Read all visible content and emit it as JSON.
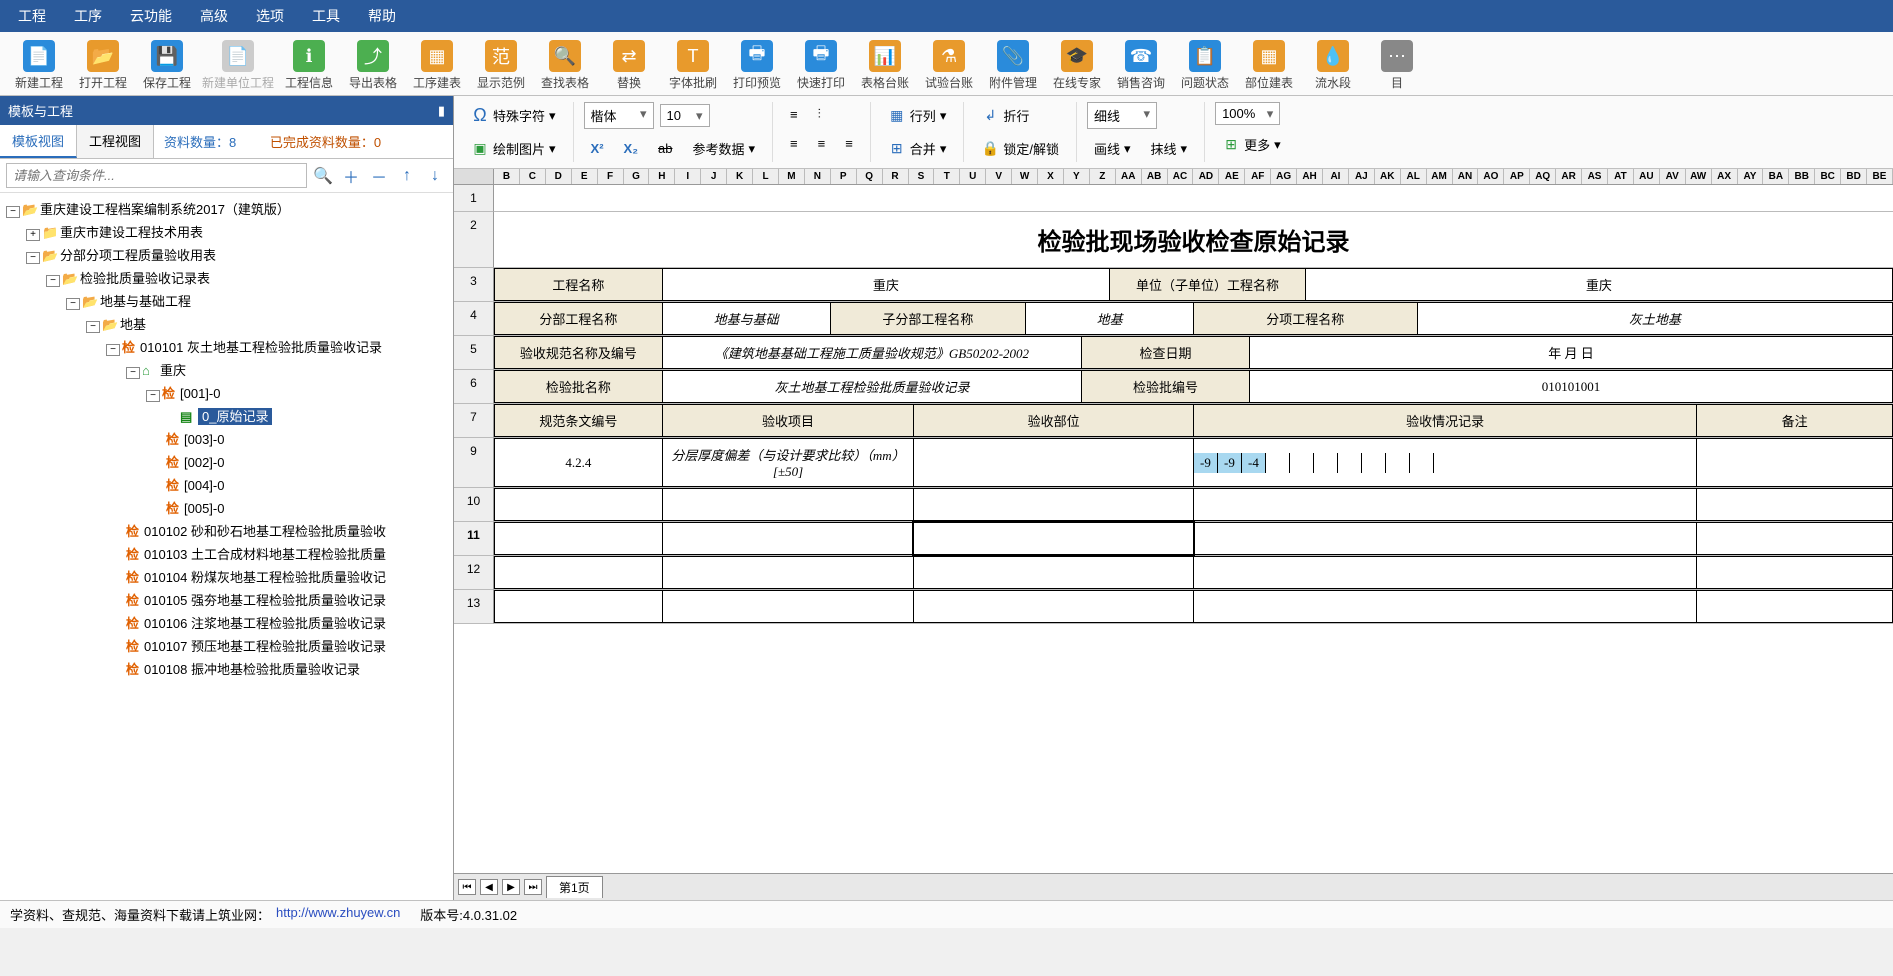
{
  "menu": [
    "工程",
    "工序",
    "云功能",
    "高级",
    "选项",
    "工具",
    "帮助"
  ],
  "toolbar": [
    {
      "label": "新建工程",
      "color": "#2a8bdb",
      "glyph": "📄"
    },
    {
      "label": "打开工程",
      "color": "#e89a2c",
      "glyph": "📂"
    },
    {
      "label": "保存工程",
      "color": "#2a8bdb",
      "glyph": "💾"
    },
    {
      "label": "新建单位工程",
      "color": "#cccccc",
      "glyph": "📄",
      "disabled": true
    },
    {
      "label": "工程信息",
      "color": "#4caf50",
      "glyph": "ℹ"
    },
    {
      "label": "导出表格",
      "color": "#4caf50",
      "glyph": "⤴"
    },
    {
      "label": "工序建表",
      "color": "#e89a2c",
      "glyph": "▦"
    },
    {
      "label": "显示范例",
      "color": "#e89a2c",
      "glyph": "范"
    },
    {
      "label": "查找表格",
      "color": "#e89a2c",
      "glyph": "🔍"
    },
    {
      "label": "替换",
      "color": "#e89a2c",
      "glyph": "⇄"
    },
    {
      "label": "字体批刷",
      "color": "#e89a2c",
      "glyph": "T"
    },
    {
      "label": "打印预览",
      "color": "#2a8bdb",
      "glyph": "🖶"
    },
    {
      "label": "快速打印",
      "color": "#2a8bdb",
      "glyph": "🖶"
    },
    {
      "label": "表格台账",
      "color": "#e89a2c",
      "glyph": "📊"
    },
    {
      "label": "试验台账",
      "color": "#e89a2c",
      "glyph": "⚗"
    },
    {
      "label": "附件管理",
      "color": "#2a8bdb",
      "glyph": "📎"
    },
    {
      "label": "在线专家",
      "color": "#e89a2c",
      "glyph": "🎓"
    },
    {
      "label": "销售咨询",
      "color": "#2a8bdb",
      "glyph": "☎"
    },
    {
      "label": "问题状态",
      "color": "#2a8bdb",
      "glyph": "📋"
    },
    {
      "label": "部位建表",
      "color": "#e89a2c",
      "glyph": "▦"
    },
    {
      "label": "流水段",
      "color": "#e89a2c",
      "glyph": "💧"
    },
    {
      "label": "目",
      "color": "#888",
      "glyph": "⋯"
    }
  ],
  "side": {
    "title": "模板与工程",
    "tabs": [
      "模板视图",
      "工程视图"
    ],
    "info_count_label": "资料数量：",
    "info_count": "8",
    "done_count_label": "已完成资料数量：",
    "done_count": "0",
    "search_placeholder": "请输入查询条件..."
  },
  "tree": {
    "root": "重庆建设工程档案编制系统2017（建筑版）",
    "n1": "重庆市建设工程技术用表",
    "n2": "分部分项工程质量验收用表",
    "n3": "检验批质量验收记录表",
    "n4": "地基与基础工程",
    "n5": "地基",
    "n6": "010101 灰土地基工程检验批质量验收记录",
    "n7": "重庆",
    "leaf1": "[001]-0",
    "leaf1b": "0_原始记录",
    "leaf2": "[003]-0",
    "leaf3": "[002]-0",
    "leaf4": "[004]-0",
    "leaf5": "[005]-0",
    "s2": "010102 砂和砂石地基工程检验批质量验收",
    "s3": "010103 土工合成材料地基工程检验批质量",
    "s4": "010104 粉煤灰地基工程检验批质量验收记",
    "s5": "010105 强夯地基工程检验批质量验收记录",
    "s6": "010106 注浆地基工程检验批质量验收记录",
    "s7": "010107 预压地基工程检验批质量验收记录",
    "s8": "010108 振冲地基检验批质量验收记录"
  },
  "ribbon": {
    "special_char": "特殊字符",
    "draw_pic": "绘制图片",
    "font": "楷体",
    "size": "10",
    "ref_data": "参考数据",
    "row_col": "行列",
    "merge": "合并",
    "wrap": "折行",
    "lock": "锁定/解锁",
    "line_style": "细线",
    "draw_line": "画线",
    "erase": "抹线",
    "zoom": "100%",
    "more": "更多"
  },
  "col_headers": [
    "B",
    "C",
    "D",
    "E",
    "F",
    "G",
    "H",
    "I",
    "J",
    "K",
    "L",
    "M",
    "N",
    "P",
    "Q",
    "R",
    "S",
    "T",
    "U",
    "V",
    "W",
    "X",
    "Y",
    "Z",
    "AA",
    "AB",
    "AC",
    "AD",
    "AE",
    "AF",
    "AG",
    "AH",
    "AI",
    "AJ",
    "AK",
    "AL",
    "AM",
    "AN",
    "AO",
    "AP",
    "AQ",
    "AR",
    "AS",
    "AT",
    "AU",
    "AV",
    "AW",
    "AX",
    "AY",
    "BA",
    "BB",
    "BC",
    "BD",
    "BE"
  ],
  "row_headers": [
    "1",
    "2",
    "3",
    "4",
    "5",
    "6",
    "7",
    "9",
    "10",
    "11",
    "12",
    "13"
  ],
  "doc": {
    "title": "检验批现场验收检查原始记录",
    "r3": {
      "a": "工程名称",
      "b": "重庆",
      "c": "单位（子单位）工程名称",
      "d": "重庆"
    },
    "r4": {
      "a": "分部工程名称",
      "b": "地基与基础",
      "c": "子分部工程名称",
      "d": "地基",
      "e": "分项工程名称",
      "f": "灰土地基"
    },
    "r5": {
      "a": "验收规范名称及编号",
      "b": "《建筑地基基础工程施工质量验收规范》GB50202-2002",
      "c": "检查日期",
      "d": "年 月 日"
    },
    "r6": {
      "a": "检验批名称",
      "b": "灰土地基工程检验批质量验收记录",
      "c": "检验批编号",
      "d": "010101001"
    },
    "r7": {
      "a": "规范条文编号",
      "b": "验收项目",
      "c": "验收部位",
      "d": "验收情况记录",
      "e": "备注"
    },
    "r9": {
      "a": "4.2.4",
      "b": "分层厚度偏差（与设计要求比较）（mm）[±50]",
      "vals": [
        "-9",
        "-9",
        "-4",
        "",
        "",
        "",
        "",
        "",
        "",
        ""
      ]
    }
  },
  "sheet_tab": "第1页",
  "status": {
    "prefix": "学资料、查规范、海量资料下载请上筑业网：",
    "url": "http://www.zhuyew.cn",
    "version_label": "版本号:",
    "version": "4.0.31.02"
  }
}
